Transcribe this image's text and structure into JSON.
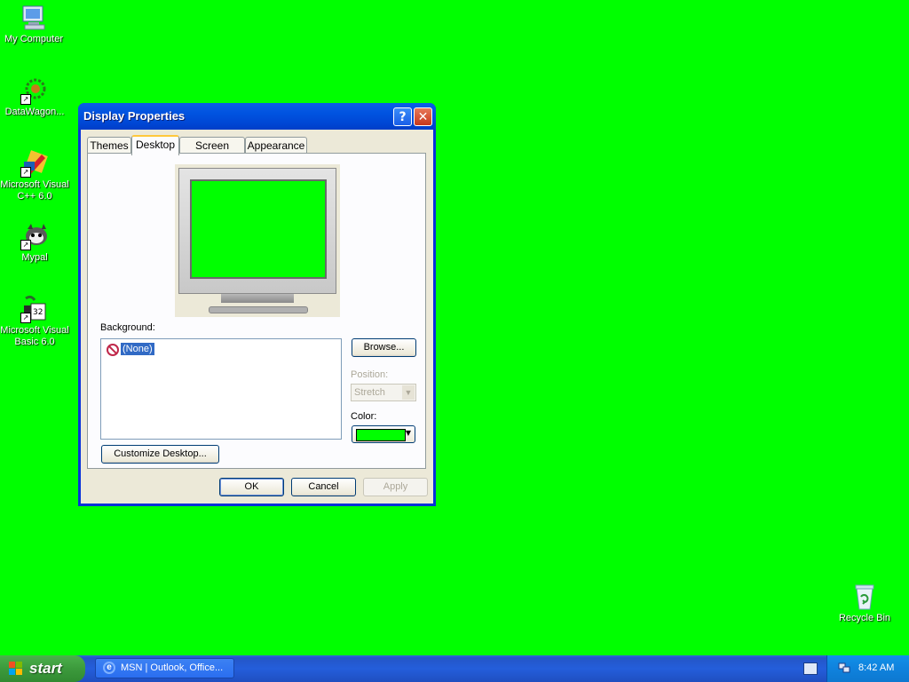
{
  "desktop": {
    "icons": [
      {
        "label": "My Computer"
      },
      {
        "label": "DataWagon..."
      },
      {
        "label": "Microsoft Visual\nC++ 6.0"
      },
      {
        "label": "Mypal"
      },
      {
        "label": "Microsoft Visual\nBasic 6.0"
      },
      {
        "label": "Recycle Bin"
      }
    ],
    "background_color": "#00ff00"
  },
  "window": {
    "title": "Display Properties",
    "help_glyph": "?",
    "close_glyph": "✕",
    "tabs": [
      "Themes",
      "Desktop",
      "Screen Saver",
      "Appearance"
    ],
    "active_tab": "Desktop",
    "background_label": "Background:",
    "background_items": [
      "(None)"
    ],
    "browse_label": "Browse...",
    "position_label": "Position:",
    "position_value": "Stretch",
    "color_label": "Color:",
    "color_value": "#00ff00",
    "customize_label": "Customize Desktop...",
    "ok_label": "OK",
    "cancel_label": "Cancel",
    "apply_label": "Apply"
  },
  "taskbar": {
    "start_label": "start",
    "task_button": "MSN | Outlook, Office...",
    "clock": "8:42 AM"
  }
}
